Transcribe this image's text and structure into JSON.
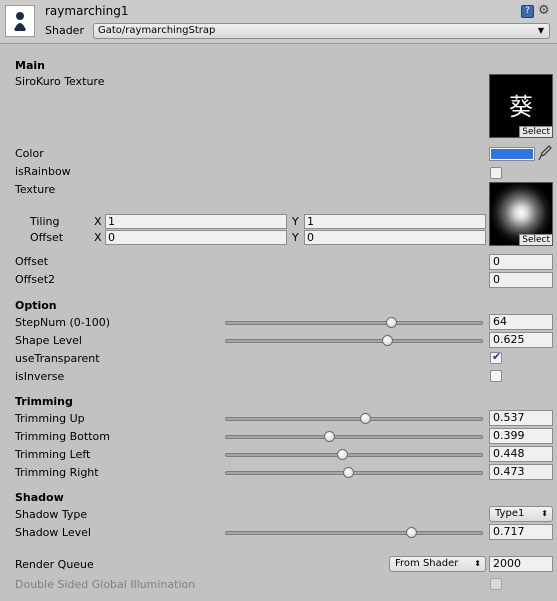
{
  "header": {
    "material_name": "raymarching1",
    "shader_label": "Shader",
    "shader_value": "Gato/raymarchingStrap"
  },
  "main": {
    "section_label": "Main",
    "sirokuro_label": "SiroKuro Texture",
    "sirokuro_glyph": "葵",
    "select_label": "Select",
    "color_label": "Color",
    "color_value": "#2d74e8",
    "israinbow_label": "isRainbow",
    "israinbow_checked": false,
    "texture_label": "Texture",
    "tiling_label": "Tiling",
    "offset_label": "Offset",
    "x_label": "X",
    "y_label": "Y",
    "tiling_x": "1",
    "tiling_y": "1",
    "offset_x": "0",
    "offset_y": "0",
    "offset_prop_label": "Offset",
    "offset_prop_value": "0",
    "offset2_label": "Offset2",
    "offset2_value": "0"
  },
  "option": {
    "section_label": "Option",
    "stepnum_label": "StepNum (0-100)",
    "stepnum_value": "64",
    "stepnum_fraction": 0.64,
    "shape_label": "Shape Level",
    "shape_value": "0.625",
    "shape_fraction": 0.625,
    "usetransparent_label": "useTransparent",
    "usetransparent_checked": true,
    "isinverse_label": "isInverse",
    "isinverse_checked": false
  },
  "trimming": {
    "section_label": "Trimming",
    "up_label": "Trimming Up",
    "up_value": "0.537",
    "up_fraction": 0.537,
    "bottom_label": "Trimming Bottom",
    "bottom_value": "0.399",
    "bottom_fraction": 0.399,
    "left_label": "Trimming Left",
    "left_value": "0.448",
    "left_fraction": 0.448,
    "right_label": "Trimming Right",
    "right_value": "0.473",
    "right_fraction": 0.473
  },
  "shadow": {
    "section_label": "Shadow",
    "type_label": "Shadow Type",
    "type_value": "Type1",
    "level_label": "Shadow Level",
    "level_value": "0.717",
    "level_fraction": 0.717
  },
  "render": {
    "queue_label": "Render Queue",
    "queue_mode": "From Shader",
    "queue_value": "2000",
    "dsgi_label": "Double Sided Global Illumination",
    "dsgi_checked": false
  }
}
